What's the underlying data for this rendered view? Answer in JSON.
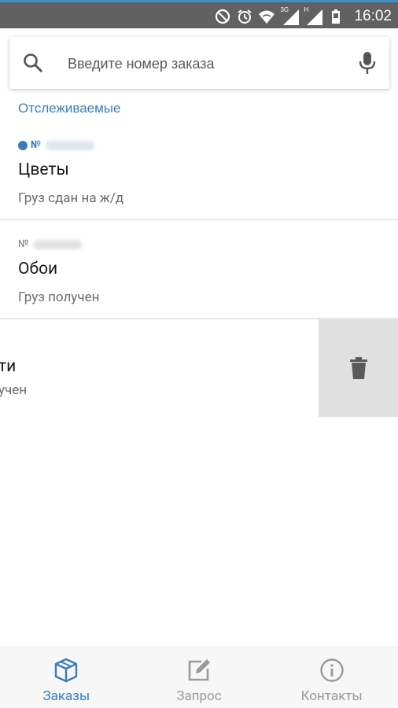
{
  "status_bar": {
    "time": "16:02",
    "signal_label_1": "3G",
    "signal_label_2": "H"
  },
  "search": {
    "placeholder": "Введите номер заказа"
  },
  "section_title": "Отслеживаемые",
  "orders": [
    {
      "number_prefix": "№",
      "title": "Цветы",
      "status": "Груз сдан на ж/д",
      "unread": true
    },
    {
      "number_prefix": "№",
      "title": "Обои",
      "status": "Груз получен",
      "unread": false
    },
    {
      "title_partial": "ти",
      "status_partial": "учен"
    }
  ],
  "bottom_nav": {
    "tabs": [
      {
        "label": "Заказы",
        "icon": "box-icon",
        "active": true
      },
      {
        "label": "Запрос",
        "icon": "edit-icon",
        "active": false
      },
      {
        "label": "Контакты",
        "icon": "info-icon",
        "active": false
      }
    ]
  },
  "colors": {
    "accent": "#3a7dbd",
    "status_bar": "#616161",
    "swipe_bg": "#e0e0e0"
  }
}
